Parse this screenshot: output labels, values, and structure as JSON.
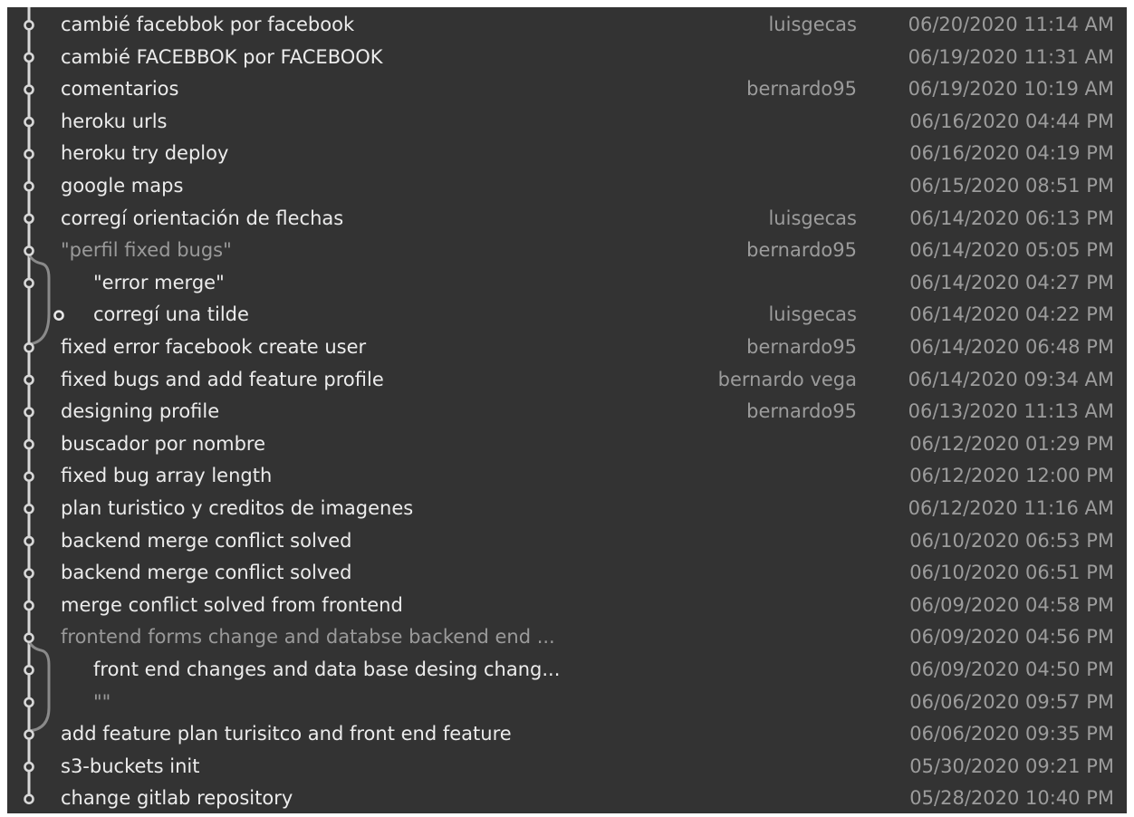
{
  "commits": [
    {
      "subject": "cambié facebbok por facebook",
      "author": "luisgecas",
      "date": "06/20/2020 11:14 AM",
      "lane": 0
    },
    {
      "subject": "cambié FACEBBOK por FACEBOOK",
      "author": "",
      "date": "06/19/2020 11:31 AM",
      "lane": 0
    },
    {
      "subject": "comentarios",
      "author": "bernardo95",
      "date": "06/19/2020 10:19 AM",
      "lane": 0
    },
    {
      "subject": "heroku urls",
      "author": "",
      "date": "06/16/2020 04:44 PM",
      "lane": 0
    },
    {
      "subject": "heroku try deploy",
      "author": "",
      "date": "06/16/2020 04:19 PM",
      "lane": 0
    },
    {
      "subject": "google maps",
      "author": "",
      "date": "06/15/2020 08:51 PM",
      "lane": 0
    },
    {
      "subject": "corregí orientación de flechas",
      "author": "luisgecas",
      "date": "06/14/2020 06:13 PM",
      "lane": 0
    },
    {
      "subject": "\"perfil fixed bugs\"",
      "author": "bernardo95",
      "date": "06/14/2020 05:05 PM",
      "lane": 0,
      "dim": true
    },
    {
      "subject": "\"error merge\"",
      "author": "",
      "date": "06/14/2020 04:27 PM",
      "lane": 0,
      "indent": true
    },
    {
      "subject": "corregí una tilde",
      "author": "luisgecas",
      "date": "06/14/2020 04:22 PM",
      "lane": 1,
      "indent": true
    },
    {
      "subject": "fixed error facebook create user",
      "author": "bernardo95",
      "date": "06/14/2020 06:48 PM",
      "lane": 0
    },
    {
      "subject": "fixed bugs and add feature profile",
      "author": "bernardo vega",
      "date": "06/14/2020 09:34 AM",
      "lane": 0
    },
    {
      "subject": "designing profile",
      "author": "bernardo95",
      "date": "06/13/2020 11:13 AM",
      "lane": 0
    },
    {
      "subject": "buscador por nombre",
      "author": "",
      "date": "06/12/2020 01:29 PM",
      "lane": 0
    },
    {
      "subject": "fixed bug array length",
      "author": "",
      "date": "06/12/2020 12:00 PM",
      "lane": 0
    },
    {
      "subject": "plan turistico y creditos de imagenes",
      "author": "",
      "date": "06/12/2020 11:16 AM",
      "lane": 0
    },
    {
      "subject": "backend merge conflict solved",
      "author": "",
      "date": "06/10/2020 06:53 PM",
      "lane": 0
    },
    {
      "subject": "backend merge conflict solved",
      "author": "",
      "date": "06/10/2020 06:51 PM",
      "lane": 0
    },
    {
      "subject": "merge conflict solved from frontend",
      "author": "",
      "date": "06/09/2020 04:58 PM",
      "lane": 0
    },
    {
      "subject": "frontend forms change and databse backend end ...",
      "author": "",
      "date": "06/09/2020 04:56 PM",
      "lane": 0,
      "dim": true
    },
    {
      "subject": "front end changes and data base desing chang...",
      "author": "",
      "date": "06/09/2020 04:50 PM",
      "lane": 0,
      "indent": true
    },
    {
      "subject": "\"\"",
      "author": "",
      "date": "06/06/2020 09:57 PM",
      "lane": 0,
      "indent": true,
      "dim": true
    },
    {
      "subject": "add feature plan turisitco and front end feature",
      "author": "",
      "date": "06/06/2020 09:35 PM",
      "lane": 0
    },
    {
      "subject": "s3-buckets init",
      "author": "",
      "date": "05/30/2020 09:21 PM",
      "lane": 0
    },
    {
      "subject": "change gitlab repository",
      "author": "",
      "date": "05/28/2020 10:40 PM",
      "lane": 0
    }
  ],
  "colors": {
    "background": "#333333",
    "text": "#ececec",
    "muted": "#9c9c9c",
    "graph_line": "#d8d8d8",
    "branch_line": "#8a8a8a"
  }
}
